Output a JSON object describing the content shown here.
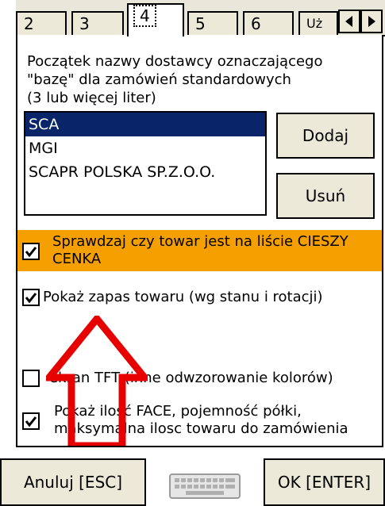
{
  "tabs": {
    "items": [
      {
        "label": "2"
      },
      {
        "label": "3"
      },
      {
        "label": "4"
      },
      {
        "label": "5"
      },
      {
        "label": "6"
      },
      {
        "label": "Uż"
      }
    ],
    "active_index": 2,
    "scroll_left_icon": "triangle-left-icon",
    "scroll_right_icon": "triangle-right-icon"
  },
  "panel": {
    "description_lines": [
      "Początek nazwy dostawcy oznaczającego",
      "\"bazę\" dla zamówień standardowych",
      "(3 lub więcej liter)"
    ],
    "supplier_list": [
      {
        "name": "SCA",
        "selected": true
      },
      {
        "name": "MGI",
        "selected": false
      },
      {
        "name": "SCAPR POLSKA SP.Z.O.O.",
        "selected": false
      }
    ],
    "add_button": "Dodaj",
    "remove_button": "Usuń",
    "options": [
      {
        "lines": [
          "Sprawdzaj czy towar jest na liście CIESZY",
          "CENKA"
        ],
        "checked": true,
        "highlighted": true
      },
      {
        "lines": [
          "Pokaż zapas towaru (wg stanu i rotacji)"
        ],
        "checked": true,
        "highlighted": false
      },
      {
        "lines": [
          "ekran TFT (inne odwzorowanie kolorów)"
        ],
        "checked": false,
        "highlighted": false
      },
      {
        "lines": [
          "Pokaż ilość FACE, pojemność półki,",
          "maksymalna ilosc towaru do zamówienia"
        ],
        "checked": true,
        "highlighted": false
      }
    ],
    "annotation_arrow_color": "#e60000",
    "highlight_color": "#f5a000",
    "selection_color": "#0a246a"
  },
  "footer": {
    "cancel_button": "Anuluj [ESC]",
    "ok_button": "OK [ENTER]",
    "keyboard_icon": "keyboard-icon"
  }
}
